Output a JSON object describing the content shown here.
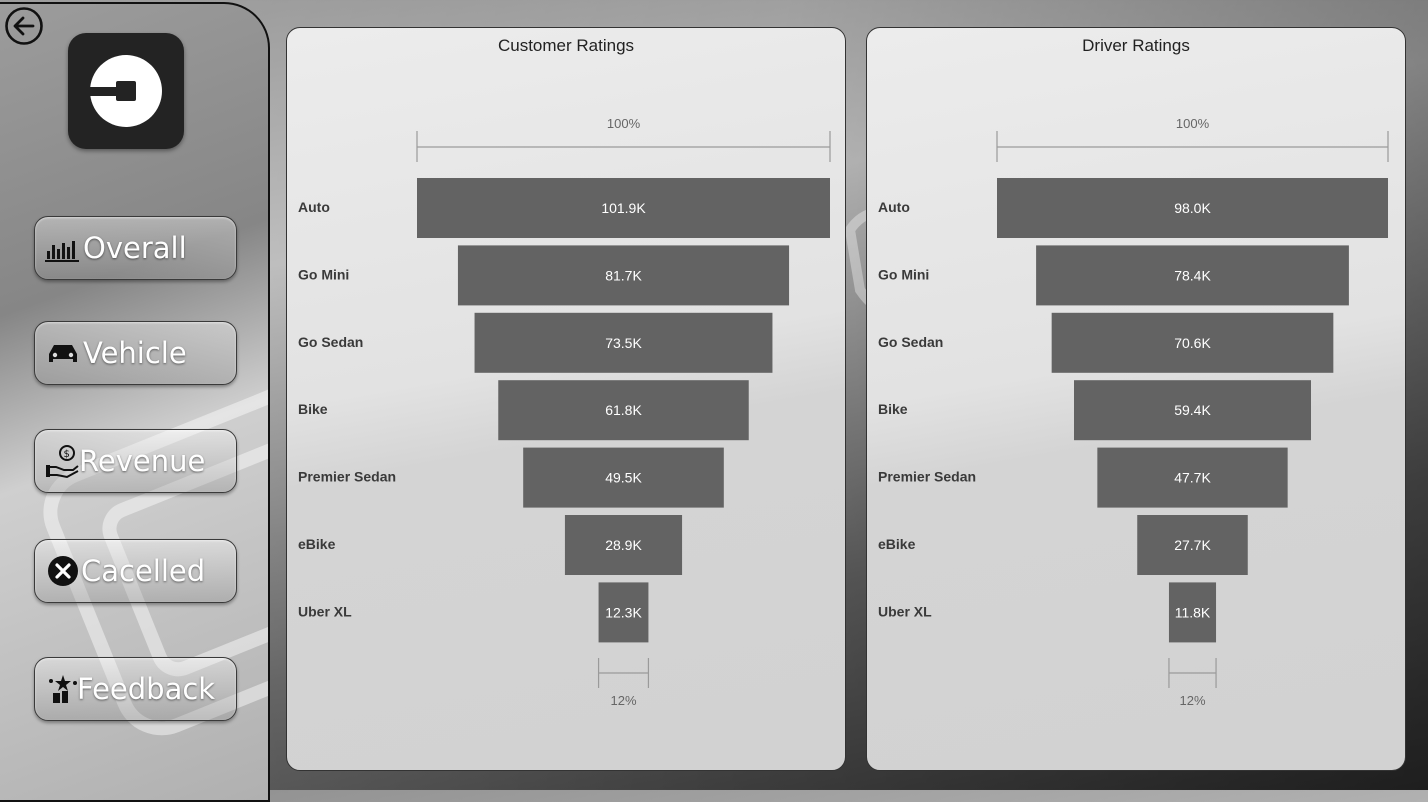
{
  "app": {
    "back_icon": "back-arrow-icon",
    "logo_icon": "uber-logo-icon"
  },
  "sidebar": {
    "items": [
      {
        "label": "Overall",
        "icon": "bar-chart-icon"
      },
      {
        "label": "Vehicle",
        "icon": "car-icon"
      },
      {
        "label": "Revenue",
        "icon": "money-hand-icon"
      },
      {
        "label": "Cacelled",
        "icon": "cancel-icon"
      },
      {
        "label": "Feedback",
        "icon": "feedback-stars-icon"
      }
    ]
  },
  "colors": {
    "bar": "#636363",
    "bar_label": "#ffffff",
    "category_label": "#3a3a3a",
    "axis": "#9a9a9a"
  },
  "chart_data": [
    {
      "type": "bar",
      "subtype": "funnel",
      "title": "Customer Ratings",
      "categories": [
        "Auto",
        "Go Mini",
        "Go Sedan",
        "Bike",
        "Premier Sedan",
        "eBike",
        "Uber XL"
      ],
      "values": [
        101.9,
        81.7,
        73.5,
        61.8,
        49.5,
        28.9,
        12.3
      ],
      "value_labels": [
        "101.9K",
        "81.7K",
        "73.5K",
        "61.8K",
        "49.5K",
        "28.9K",
        "12.3K"
      ],
      "units": "K",
      "top_label": "100%",
      "bottom_label": "12%"
    },
    {
      "type": "bar",
      "subtype": "funnel",
      "title": "Driver Ratings",
      "categories": [
        "Auto",
        "Go Mini",
        "Go Sedan",
        "Bike",
        "Premier Sedan",
        "eBike",
        "Uber XL"
      ],
      "values": [
        98.0,
        78.4,
        70.6,
        59.4,
        47.7,
        27.7,
        11.8
      ],
      "value_labels": [
        "98.0K",
        "78.4K",
        "70.6K",
        "59.4K",
        "47.7K",
        "27.7K",
        "11.8K"
      ],
      "units": "K",
      "top_label": "100%",
      "bottom_label": "12%"
    }
  ]
}
